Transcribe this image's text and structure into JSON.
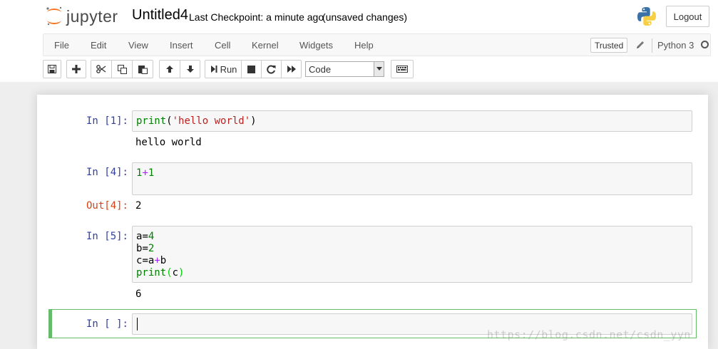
{
  "header": {
    "logo_text": "jupyter",
    "notebook_title": "Untitled4",
    "checkpoint": "Last Checkpoint: a minute ago",
    "unsaved": "(unsaved changes)",
    "logout_label": "Logout",
    "python_icon": "python-logo-icon"
  },
  "menubar": {
    "items": [
      "File",
      "Edit",
      "View",
      "Insert",
      "Cell",
      "Kernel",
      "Widgets",
      "Help"
    ],
    "trusted_label": "Trusted",
    "kernel_name": "Python 3",
    "pencil_icon": "pencil-icon",
    "kernel_status_icon": "kernel-idle-circle-icon"
  },
  "toolbar": {
    "run_label": "Run",
    "cell_type": "Code",
    "icons": [
      "save-icon",
      "plus-icon",
      "cut-icon",
      "copy-icon",
      "paste-icon",
      "arrow-up-icon",
      "arrow-down-icon",
      "run-icon",
      "stop-icon",
      "restart-icon",
      "fast-forward-icon",
      "keyboard-icon"
    ]
  },
  "cells": [
    {
      "in_prompt": "In [1]:",
      "output": "hello world"
    },
    {
      "in_prompt": "In [4]:",
      "out_prompt": "Out[4]:",
      "output": "2"
    },
    {
      "in_prompt": "In [5]:",
      "output": "6"
    },
    {
      "in_prompt": "In [ ]:"
    }
  ],
  "code": {
    "c1_func": "print",
    "c1_open": "(",
    "c1_str": "'hello world'",
    "c1_close": ")",
    "c2_a": "1",
    "c2_op": "+",
    "c2_b": "1",
    "c3_l1_var": "a",
    "c3_l1_eq": "=",
    "c3_l1_val": "4",
    "c3_l2_var": "b",
    "c3_l2_eq": "=",
    "c3_l2_val": "2",
    "c3_l3_var": "c",
    "c3_l3_eq": "=",
    "c3_l3_a": "a",
    "c3_l3_op": "+",
    "c3_l3_b": "b",
    "c3_l4_func": "print",
    "c3_l4_open": "(",
    "c3_l4_arg": "c",
    "c3_l4_close": ")"
  },
  "watermark": "https://blog.csdn.net/csdn_yyn",
  "colors": {
    "in_prompt": "#303f9f",
    "out_prompt": "#d84315",
    "selected_border": "#66bb6a",
    "jupyter_orange": "#f37726"
  }
}
